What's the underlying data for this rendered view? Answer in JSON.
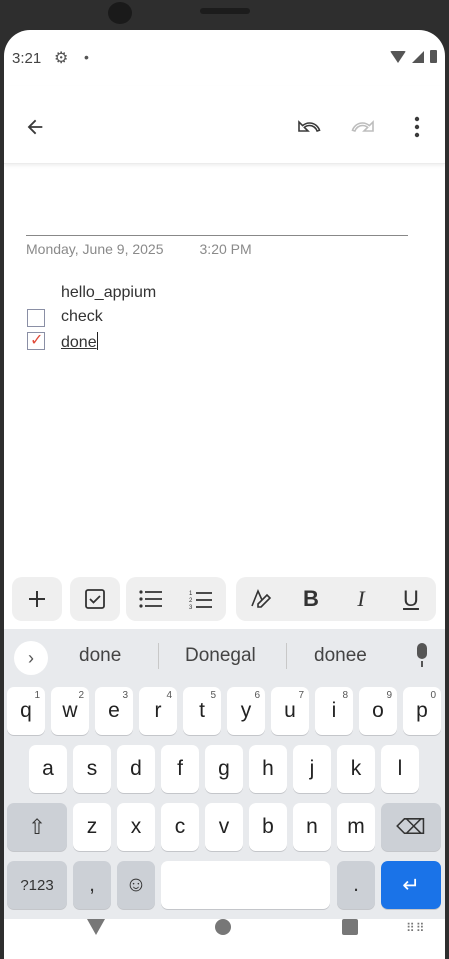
{
  "status_bar": {
    "time": "3:21",
    "settings_icon": "gear-icon",
    "dot": "•"
  },
  "app_bar": {
    "back_icon": "arrow-left-icon",
    "undo_icon": "undo-icon",
    "redo_icon": "redo-icon",
    "more_icon": "more-vert-icon"
  },
  "note": {
    "date": "Monday, June 9, 2025",
    "time": "3:20 PM",
    "lines": [
      {
        "text": "hello_appium",
        "checkbox": null
      },
      {
        "text": "check",
        "checkbox": false
      },
      {
        "text": "done",
        "checkbox": true
      }
    ]
  },
  "format_toolbar": {
    "add": "+",
    "checklist": "☑",
    "bullets": "☰",
    "numbered": "1≡",
    "style": "A",
    "bold": "B",
    "italic": "I",
    "underline": "U"
  },
  "keyboard": {
    "suggestions": [
      "done",
      "Donegal",
      "donee"
    ],
    "row1": [
      {
        "key": "q",
        "hint": "1"
      },
      {
        "key": "w",
        "hint": "2"
      },
      {
        "key": "e",
        "hint": "3"
      },
      {
        "key": "r",
        "hint": "4"
      },
      {
        "key": "t",
        "hint": "5"
      },
      {
        "key": "y",
        "hint": "6"
      },
      {
        "key": "u",
        "hint": "7"
      },
      {
        "key": "i",
        "hint": "8"
      },
      {
        "key": "o",
        "hint": "9"
      },
      {
        "key": "p",
        "hint": "0"
      }
    ],
    "row2": [
      "a",
      "s",
      "d",
      "f",
      "g",
      "h",
      "j",
      "k",
      "l"
    ],
    "row3": [
      "z",
      "x",
      "c",
      "v",
      "b",
      "n",
      "m"
    ],
    "symbols_label": "?123",
    "comma": ",",
    "emoji": "☺",
    "period": ".",
    "enter": "↵",
    "shift": "⇧",
    "backspace": "⌫"
  },
  "colors": {
    "accent": "#1a73e8",
    "check": "#e04b3a",
    "keyboard_bg": "#e8eaed"
  }
}
